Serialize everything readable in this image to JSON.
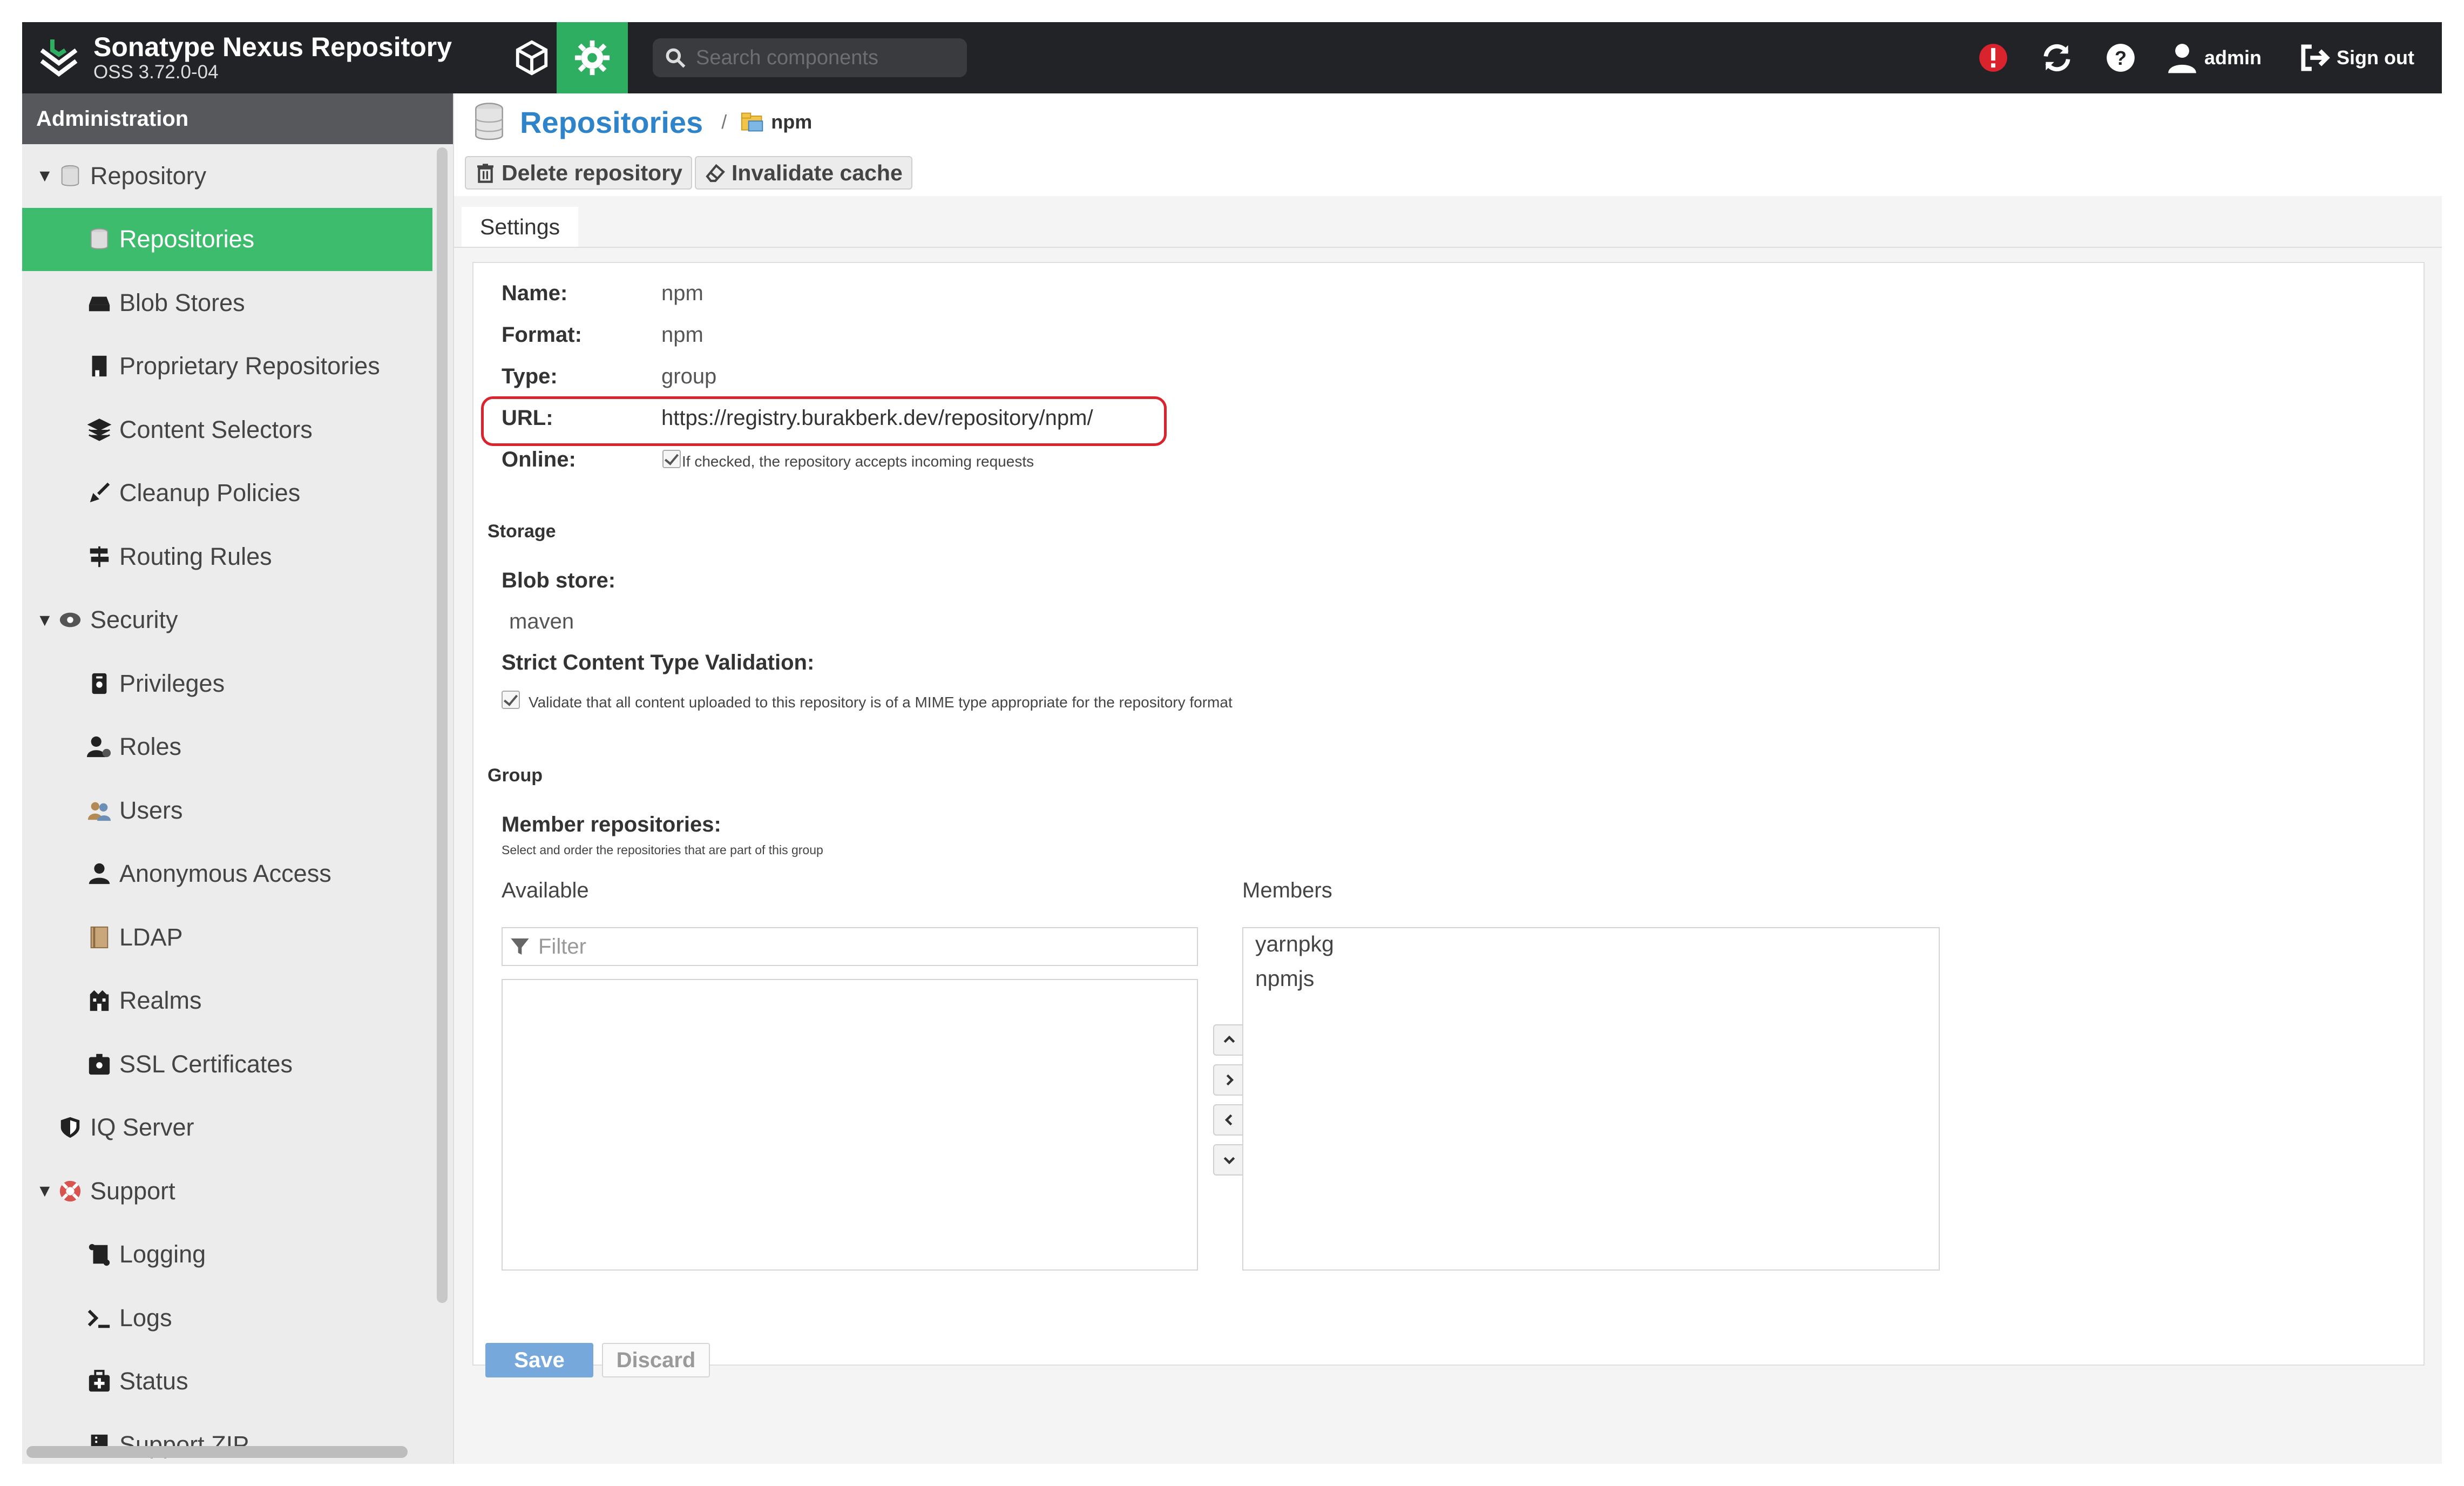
{
  "app": {
    "title": "Sonatype Nexus Repository",
    "version": "OSS 3.72.0-04"
  },
  "header": {
    "search_placeholder": "Search components",
    "user": "admin",
    "sign_out": "Sign out",
    "alert_icon": "alert-icon",
    "refresh_icon": "refresh-icon",
    "help_icon": "help-icon"
  },
  "sidebar": {
    "heading": "Administration",
    "items": [
      {
        "label": "Repository",
        "level": 0,
        "expanded": true,
        "icon": "database-icon"
      },
      {
        "label": "Repositories",
        "level": 1,
        "active": true,
        "icon": "database-icon"
      },
      {
        "label": "Blob Stores",
        "level": 1,
        "icon": "hard-drive-icon"
      },
      {
        "label": "Proprietary Repositories",
        "level": 1,
        "icon": "building-icon"
      },
      {
        "label": "Content Selectors",
        "level": 1,
        "icon": "layers-icon"
      },
      {
        "label": "Cleanup Policies",
        "level": 1,
        "icon": "broom-icon"
      },
      {
        "label": "Routing Rules",
        "level": 1,
        "icon": "signpost-icon"
      },
      {
        "label": "Security",
        "level": 0,
        "expanded": true,
        "icon": "eye-icon"
      },
      {
        "label": "Privileges",
        "level": 1,
        "icon": "badge-icon"
      },
      {
        "label": "Roles",
        "level": 1,
        "icon": "users-cog-icon"
      },
      {
        "label": "Users",
        "level": 1,
        "icon": "users-icon"
      },
      {
        "label": "Anonymous Access",
        "level": 1,
        "icon": "user-icon"
      },
      {
        "label": "LDAP",
        "level": 1,
        "icon": "book-icon"
      },
      {
        "label": "Realms",
        "level": 1,
        "icon": "realm-icon"
      },
      {
        "label": "SSL Certificates",
        "level": 1,
        "icon": "certificate-icon"
      },
      {
        "label": "IQ Server",
        "level": 0,
        "icon": "shield-icon"
      },
      {
        "label": "Support",
        "level": 0,
        "expanded": true,
        "icon": "lifebuoy-icon"
      },
      {
        "label": "Logging",
        "level": 1,
        "icon": "scroll-icon"
      },
      {
        "label": "Logs",
        "level": 1,
        "icon": "terminal-icon"
      },
      {
        "label": "Status",
        "level": 1,
        "icon": "medkit-icon"
      },
      {
        "label": "Support ZIP",
        "level": 1,
        "icon": "zip-icon"
      }
    ]
  },
  "breadcrumb": {
    "title": "Repositories",
    "separator": "/",
    "current": "npm"
  },
  "toolbar": {
    "delete_label": "Delete repository",
    "invalidate_label": "Invalidate cache"
  },
  "tabs": {
    "settings": "Settings"
  },
  "settings": {
    "name_label": "Name:",
    "name_value": "npm",
    "format_label": "Format:",
    "format_value": "npm",
    "type_label": "Type:",
    "type_value": "group",
    "url_label": "URL:",
    "url_value": "https://registry.burakberk.dev/repository/npm/",
    "online_label": "Online:",
    "online_help": "If checked, the repository accepts incoming requests",
    "online_checked": true
  },
  "storage": {
    "heading": "Storage",
    "blob_label": "Blob store:",
    "blob_value": "maven",
    "strict_label": "Strict Content Type Validation:",
    "strict_help": "Validate that all content uploaded to this repository is of a MIME type appropriate for the repository format",
    "strict_checked": true
  },
  "group": {
    "heading": "Group",
    "member_label": "Member repositories:",
    "member_help": "Select and order the repositories that are part of this group",
    "available_label": "Available",
    "filter_placeholder": "Filter",
    "members_label": "Members",
    "members": [
      "yarnpkg",
      "npmjs"
    ]
  },
  "actions": {
    "save": "Save",
    "discard": "Discard"
  },
  "colors": {
    "header_bg": "#222326",
    "accent_green": "#3dbc6d",
    "link_blue": "#2f84c9",
    "highlight_red": "#d9232d",
    "save_blue": "#77a8dc"
  }
}
